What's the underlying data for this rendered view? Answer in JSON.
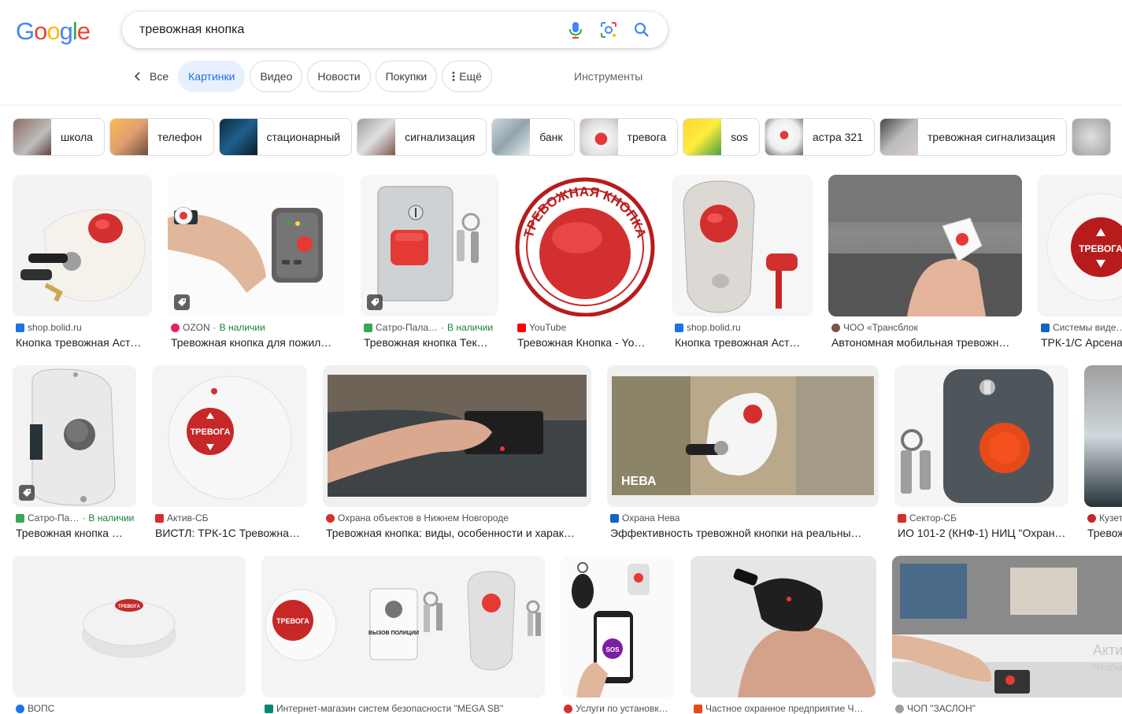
{
  "logo": [
    "G",
    "o",
    "o",
    "g",
    "l",
    "e"
  ],
  "search": {
    "query": "тревожная кнопка"
  },
  "tabs": {
    "back": "Все",
    "images": "Картинки",
    "video": "Видео",
    "news": "Новости",
    "shopping": "Покупки",
    "more": "Ещё",
    "tools": "Инструменты"
  },
  "chips": [
    "школа",
    "телефон",
    "стационарный",
    "сигнализация",
    "банк",
    "тревога",
    "sos",
    "астра 321",
    "тревожная сигнализация"
  ],
  "results": [
    {
      "source": "shop.bolid.ru",
      "avail": "",
      "title": "Кнопка тревожная Аст…",
      "fav": "#1a73e8"
    },
    {
      "source": "OZON",
      "avail": "В наличии",
      "title": "Тревожная кнопка для пожил…",
      "fav": "#e91e63"
    },
    {
      "source": "Сатро-Пала…",
      "avail": "В наличии",
      "title": "Тревожная кнопка Тек…",
      "fav": "#34a853"
    },
    {
      "source": "YouTube",
      "avail": "",
      "title": "Тревожная Кнопка - Yo…",
      "fav": "#ff0000"
    },
    {
      "source": "shop.bolid.ru",
      "avail": "",
      "title": "Кнопка тревожная Аст…",
      "fav": "#1a73e8"
    },
    {
      "source": "ЧОО «Трансблок",
      "avail": "",
      "title": "Автономная мобильная тревожн…",
      "fav": "#795548"
    },
    {
      "source": "Системы виде…",
      "avail": "",
      "title": "ТРК-1/С Арсена…",
      "fav": "#1565c0"
    },
    {
      "source": "Сатро-Па…",
      "avail": "В наличии",
      "title": "Тревожная кнопка …",
      "fav": "#34a853"
    },
    {
      "source": "Актив-СБ",
      "avail": "",
      "title": "ВИСТЛ: ТРК-1С Тревожна…",
      "fav": "#d32f2f"
    },
    {
      "source": "Охрана объектов в Нижнем Новгороде",
      "avail": "",
      "title": "Тревожная кнопка: виды, особенности и харак…",
      "fav": "#d32f2f"
    },
    {
      "source": "Охрана Нева",
      "avail": "",
      "title": "Эффективность тревожной кнопки на реальны…",
      "fav": "#1565c0"
    },
    {
      "source": "Сектор-СБ",
      "avail": "",
      "title": "ИО 101-2 (КНФ-1) НИЦ \"Охран…",
      "fav": "#d32f2f"
    },
    {
      "source": "Кузет…",
      "avail": "",
      "title": "Тревож…",
      "fav": "#c62828"
    },
    {
      "source": "ВОПС",
      "avail": "",
      "title": "",
      "fav": "#1a73e8"
    },
    {
      "source": "Интернет-магазин систем безопасности \"MEGA SB\"",
      "avail": "",
      "title": "",
      "fav": "#00897b"
    },
    {
      "source": "Услуги по установк…",
      "avail": "",
      "title": "",
      "fav": "#d32f2f"
    },
    {
      "source": "Частное охранное предприятие Ч…",
      "avail": "",
      "title": "",
      "fav": "#e64a19"
    },
    {
      "source": "ЧОП \"ЗАСЛОН\"",
      "avail": "",
      "title": "",
      "fav": "#9e9e9e"
    }
  ],
  "image_text": {
    "trevoga": "ТРЕВОГА",
    "sos": "SOS",
    "neva": "НЕВА",
    "round_label": "ТРЕВОЖНАЯ КНОПКА",
    "police": "ВЫЗОВ ПОЛИЦИИ"
  },
  "watermark": {
    "line1": "Акти",
    "line2": "Чтобы"
  }
}
